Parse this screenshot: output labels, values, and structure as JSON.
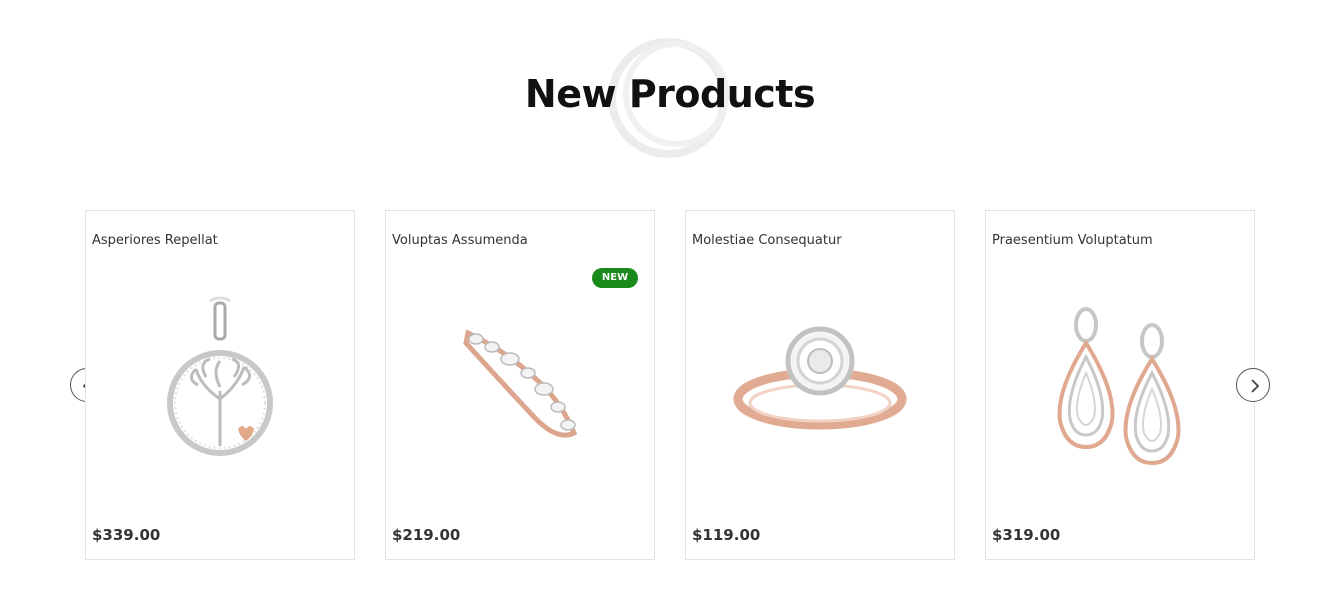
{
  "section": {
    "title": "New Products"
  },
  "carousel": {
    "prev_icon": "chevron-left-icon",
    "next_icon": "chevron-right-icon"
  },
  "products": [
    {
      "name": "Asperiores Repellat",
      "price": "$339.00",
      "image": "tree-of-life-pendant"
    },
    {
      "name": "Voluptas Assumenda",
      "price": "$219.00",
      "image": "rose-gold-diamond-band",
      "badge": "NEW"
    },
    {
      "name": "Molestiae Consequatur",
      "price": "$119.00",
      "image": "halo-engagement-ring"
    },
    {
      "name": "Praesentium Voluptatum",
      "price": "$319.00",
      "image": "teardrop-earrings"
    }
  ],
  "colors": {
    "badge": "#1a8a1a",
    "rose_gold": "#d9a08a",
    "silver": "#b8b8b8"
  }
}
